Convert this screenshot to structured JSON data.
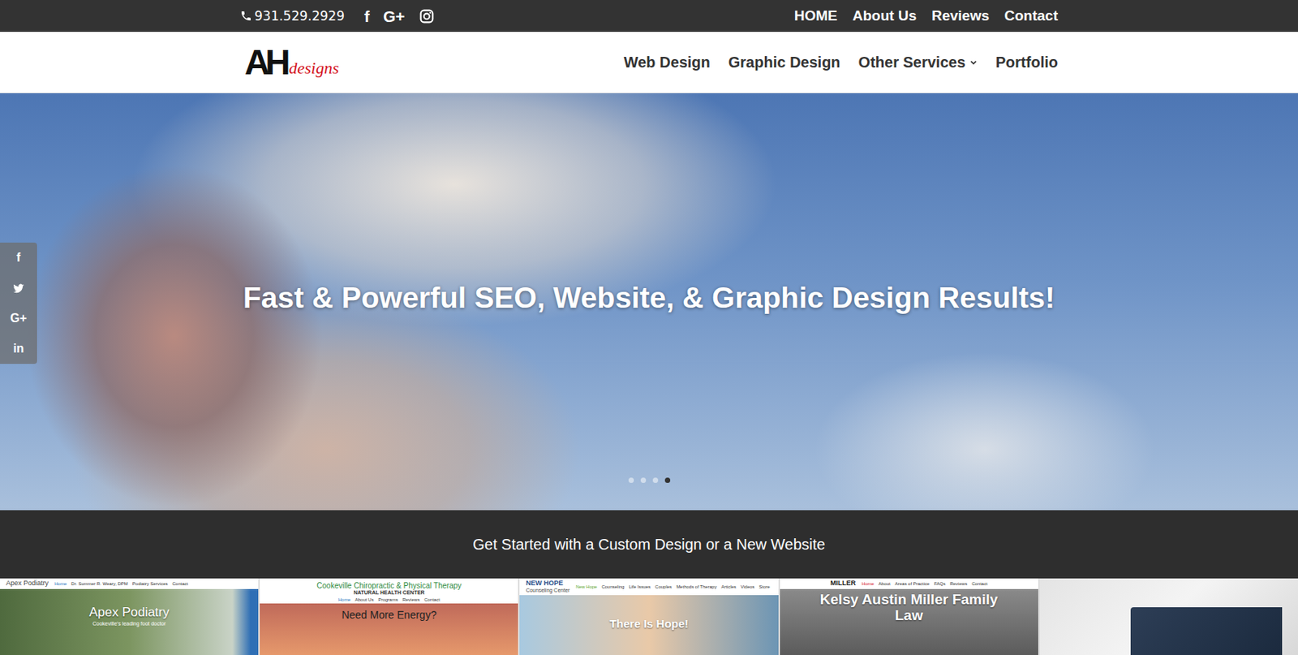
{
  "topbar": {
    "phone": "931.529.2929",
    "social": [
      {
        "kind": "glyph",
        "glyph": "f"
      },
      {
        "kind": "glyph",
        "glyph": "G+"
      },
      {
        "kind": "instagram"
      }
    ],
    "links": [
      "HOME",
      "About Us",
      "Reviews",
      "Contact"
    ]
  },
  "header": {
    "logo": {
      "mark": "AH",
      "script": "designs"
    },
    "nav": [
      {
        "label": "Web Design",
        "dropdown": false
      },
      {
        "label": "Graphic Design",
        "dropdown": false
      },
      {
        "label": "Other Services",
        "dropdown": true
      },
      {
        "label": "Portfolio",
        "dropdown": false
      }
    ]
  },
  "hero": {
    "title": "Fast & Powerful SEO, Website, & Graphic Design Results!",
    "slides": [
      {
        "selected": false
      },
      {
        "selected": false
      },
      {
        "selected": false
      },
      {
        "selected": true
      }
    ]
  },
  "side_share": [
    {
      "kind": "glyph",
      "glyph": "f"
    },
    {
      "kind": "twitter"
    },
    {
      "kind": "glyph",
      "glyph": "G+"
    },
    {
      "kind": "glyph",
      "glyph": "in"
    }
  ],
  "cta": {
    "text": "Get Started with a Custom Design or a New Website"
  },
  "portfolio": [
    {
      "kind": "site",
      "logo": [
        "Apex Podiatry"
      ],
      "nav": [
        {
          "label": "Home",
          "selected": true
        },
        {
          "label": "Dr. Summer R. Weary, DPM",
          "selected": false
        },
        {
          "label": "Podiatry Services",
          "selected": false
        },
        {
          "label": "Contact",
          "selected": false
        }
      ],
      "headline": "Apex Podiatry",
      "sub": "Cookeville's leading foot doctor"
    },
    {
      "kind": "site",
      "logo": [
        "Cookeville Chiropractic & Physical Therapy",
        "NATURAL HEALTH CENTER"
      ],
      "nav": [
        {
          "label": "Home",
          "selected": true
        },
        {
          "label": "About Us",
          "selected": false
        },
        {
          "label": "Programs",
          "selected": false
        },
        {
          "label": "Reviews",
          "selected": false
        },
        {
          "label": "Contact",
          "selected": false
        }
      ],
      "headline": "Need More Energy?",
      "sub": ""
    },
    {
      "kind": "site",
      "logo": [
        "NEW HOPE",
        "Counseling Center"
      ],
      "nav": [
        {
          "label": "New Hope",
          "selected": true
        },
        {
          "label": "Counseling",
          "selected": false
        },
        {
          "label": "Life Issues",
          "selected": false
        },
        {
          "label": "Couples",
          "selected": false
        },
        {
          "label": "Methods of Therapy",
          "selected": false
        },
        {
          "label": "Articles",
          "selected": false
        },
        {
          "label": "Videos",
          "selected": false
        },
        {
          "label": "Store",
          "selected": false
        }
      ],
      "headline": "There Is Hope!",
      "sub": ""
    },
    {
      "kind": "site",
      "logo": [
        "MILLER"
      ],
      "nav": [
        {
          "label": "Home",
          "selected": true
        },
        {
          "label": "About",
          "selected": false
        },
        {
          "label": "Areas of Practice",
          "selected": false
        },
        {
          "label": "FAQs",
          "selected": false
        },
        {
          "label": "Reviews",
          "selected": false
        },
        {
          "label": "Contact",
          "selected": false
        }
      ],
      "headline": "Kelsy Austin Miller Family Law",
      "sub": ""
    },
    {
      "kind": "card",
      "logo": [],
      "nav": [],
      "headline": "",
      "sub": ""
    }
  ]
}
